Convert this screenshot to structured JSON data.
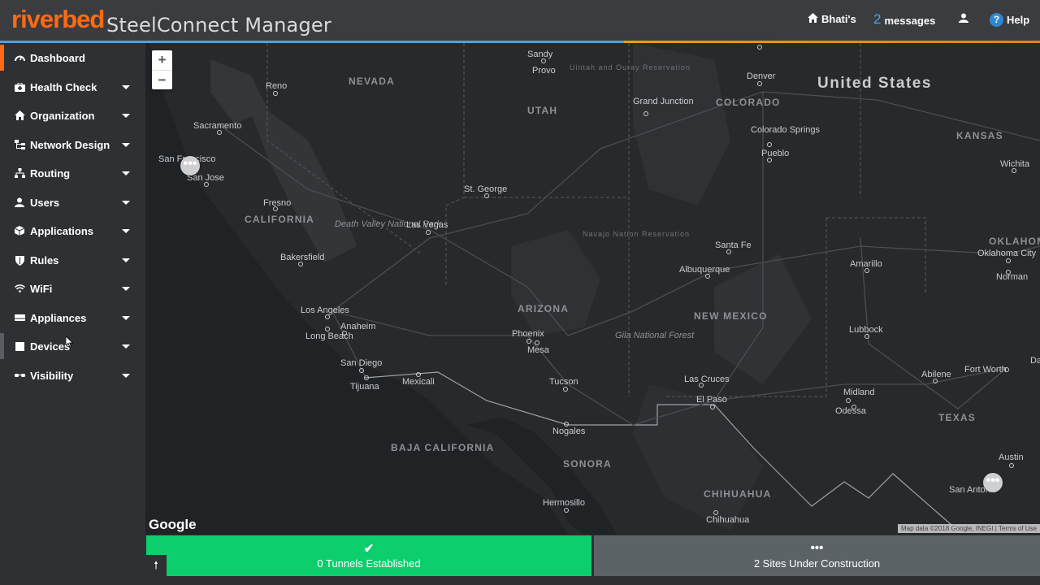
{
  "header": {
    "logo": "riverbed",
    "title": "SteelConnect Manager",
    "org": "Bhati's",
    "messages_count": "2",
    "messages_label": "messages",
    "help": "Help"
  },
  "sidebar": {
    "items": [
      {
        "label": "Dashboard",
        "icon": "dashboard-icon"
      },
      {
        "label": "Health Check",
        "icon": "medkit-icon"
      },
      {
        "label": "Organization",
        "icon": "home-icon"
      },
      {
        "label": "Network Design",
        "icon": "sitemap-icon"
      },
      {
        "label": "Routing",
        "icon": "routing-icon"
      },
      {
        "label": "Users",
        "icon": "user-icon"
      },
      {
        "label": "Applications",
        "icon": "cube-icon"
      },
      {
        "label": "Rules",
        "icon": "shield-icon"
      },
      {
        "label": "WiFi",
        "icon": "wifi-icon"
      },
      {
        "label": "Appliances",
        "icon": "hdd-icon"
      },
      {
        "label": "Devices",
        "icon": "square-icon"
      },
      {
        "label": "Visibility",
        "icon": "glasses-icon"
      }
    ]
  },
  "map": {
    "zoom_in": "+",
    "zoom_out": "−",
    "google": "Google",
    "attribution": "Map data ©2018 Google, INEGI | Terms of Use",
    "labels": {
      "country": "United States",
      "states": [
        "NEVADA",
        "UTAH",
        "COLORADO",
        "KANSAS",
        "CALIFORNIA",
        "ARIZONA",
        "NEW MEXICO",
        "TEXAS",
        "OKLAHOMA",
        "BAJA CALIFORNIA",
        "SONORA",
        "CHIHUAHUA"
      ],
      "cities": [
        "Reno",
        "Sacramento",
        "San Francisco",
        "San Jose",
        "Fresno",
        "Bakersfield",
        "Las Vegas",
        "Los Angeles",
        "Anaheim",
        "Long Beach",
        "San Diego",
        "Tijuana",
        "Mexicali",
        "Phoenix",
        "Mesa",
        "Tucson",
        "Nogales",
        "Hermosillo",
        "Provo",
        "Sandy",
        "Denver",
        "Grand Junction",
        "Colorado Springs",
        "Pueblo",
        "St. George",
        "Santa Fe",
        "Albuquerque",
        "Las Cruces",
        "El Paso",
        "Amarillo",
        "Lubbock",
        "Midland",
        "Odessa",
        "Abilene",
        "Fort Worth",
        "Dallas",
        "Austin",
        "San Antonio",
        "Wichita",
        "Oklahoma City",
        "Norman",
        "Chihuahua"
      ],
      "parks": [
        "Death Valley National Park",
        "Gila National Forest",
        "Navajo Nation Reservation",
        "Uintah and Ouray Reservation"
      ]
    }
  },
  "status": {
    "tunnels": "0 Tunnels Established",
    "sites": "2 Sites Under Construction"
  },
  "colors": {
    "brand": "#ff6a13",
    "link": "#4aa3df",
    "success": "#0dce6d",
    "neutral": "#5c6367"
  }
}
